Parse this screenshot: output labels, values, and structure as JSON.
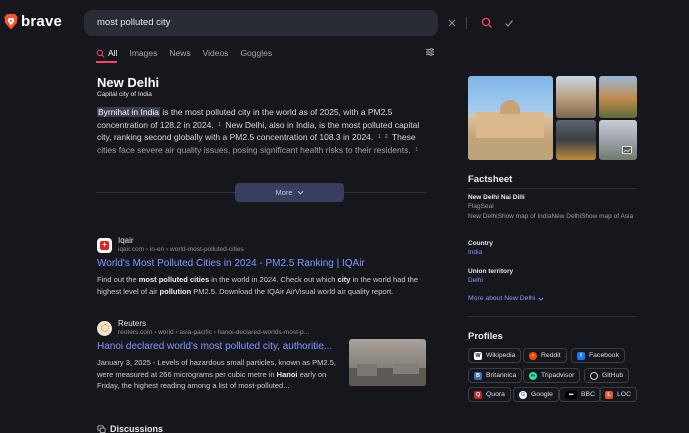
{
  "brand": {
    "name": "brave",
    "accent": "#f2475c"
  },
  "search": {
    "query": "most polluted city"
  },
  "tabs": [
    {
      "label": "All",
      "icon": "search-icon",
      "active": true
    },
    {
      "label": "Images"
    },
    {
      "label": "News"
    },
    {
      "label": "Videos"
    },
    {
      "label": "Goggles"
    }
  ],
  "answer": {
    "title": "New Delhi",
    "subtitle": "Capital city of India",
    "highlight": "Byrnihat in India",
    "p1": " is the most polluted city in the world as of 2025, with a PM2.5 concentration of 128.2 in 2024.",
    "cite1": "1",
    "p2": "New Delhi, also in India, is the most polluted capital city, ranking second globally with a PM2.5 concentration of 108.3 in 2024.",
    "cite2": "1",
    "cite3": "2",
    "p3": "These cities face severe air quality issues, posing significant health risks to their residents.",
    "cite4": "1",
    "more_label": "More"
  },
  "results": [
    {
      "site": "Iqair",
      "url": "iqair.com › in-en › world-most-polluted-cities",
      "title": "World's Most Polluted Cities in 2024 - PM2.5 Ranking | IQAir",
      "d1": "Find out the ",
      "d2": "most polluted cities",
      "d3": " in the world in 2024. Check out which ",
      "d4": "city",
      "d5": " in the world had the highest level of air ",
      "d6": "pollution",
      "d7": " PM2.5. Download the IQAir AirVisual world air quality report."
    },
    {
      "site": "Reuters",
      "url": "reuters.com › world › asia-pacific › hanoi-declared-worlds-most-p...",
      "title": "Hanoi declared world's most polluted city, authoritie...",
      "d1": "January 3, 2025 - ",
      "d2": "Levels of hazardous small particles, known as PM2.5, were measured at 266 micrograms per cubic metre in ",
      "d3": "Hanoi",
      "d4": " early on Friday, the highest reading among a list of most-polluted..."
    }
  ],
  "discussions_label": "Discussions",
  "factsheet": {
    "title": "Factsheet",
    "name_key": "New Delhi Nai Dilli",
    "name_v1": "FlagSeal",
    "name_v2": "New DelhiShow map of IndiaNew DelhiShow map of Asia",
    "country_key": "Country",
    "country_val": "India",
    "union_key": "Union territory",
    "union_val": "Delhi",
    "more_about": "More about New Delhi"
  },
  "profiles": {
    "title": "Profiles",
    "items": [
      {
        "label": "Wikipedia",
        "icon": "wikipedia-icon"
      },
      {
        "label": "Reddit",
        "icon": "reddit-icon",
        "color": "#ff4500"
      },
      {
        "label": "Facebook",
        "icon": "facebook-icon",
        "color": "#1877f2"
      },
      {
        "label": "Britannica",
        "icon": "britannica-icon",
        "color": "#3a6fb0"
      },
      {
        "label": "Tripadvisor",
        "icon": "tripadvisor-icon",
        "color": "#34e0a1"
      },
      {
        "label": "GitHub",
        "icon": "github-icon"
      },
      {
        "label": "Quora",
        "icon": "quora-icon",
        "color": "#b92b27"
      },
      {
        "label": "Google",
        "icon": "google-icon"
      },
      {
        "label": "BBC",
        "icon": "bbc-icon"
      },
      {
        "label": "LOC",
        "icon": "loc-icon",
        "color": "#e4572e"
      }
    ]
  }
}
